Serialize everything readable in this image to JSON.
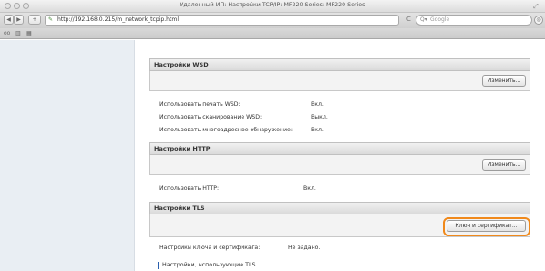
{
  "window": {
    "title": "Удаленный ИП: Настройки TCP/IP: MF220 Series: MF220 Series"
  },
  "toolbar": {
    "back_glyph": "◀",
    "forward_glyph": "▶",
    "add_glyph": "+",
    "url": "http://192.168.0.215/m_network_tcpip.html",
    "reload_glyph": "C",
    "search_placeholder": "Google",
    "search_icon_glyph": "Q▾",
    "download_glyph": "◎"
  },
  "bookmarks_bar": {
    "reading_list_glyph": "oo",
    "top_sites_glyph": "▥",
    "grid_glyph": "▦"
  },
  "sections": {
    "wsd": {
      "title": "Настройки WSD",
      "edit_label": "Изменить...",
      "rows": [
        {
          "label": "Использовать печать WSD:",
          "value": "Вкл."
        },
        {
          "label": "Использовать сканирование WSD:",
          "value": "Выкл."
        },
        {
          "label": "Использовать многоадресное обнаружение:",
          "value": "Вкл."
        }
      ]
    },
    "http": {
      "title": "Настройки HTTP",
      "edit_label": "Изменить...",
      "rows": [
        {
          "label": "Использовать HTTP:",
          "value": "Вкл."
        }
      ]
    },
    "tls": {
      "title": "Настройки TLS",
      "keys_label": "Ключ и сертификат...",
      "rows": [
        {
          "label": "Настройки ключа и сертификата:",
          "value": "Не задано."
        }
      ],
      "subheading": "Настройки, использующие TLS"
    }
  },
  "colors": {
    "highlight": "#f0891b",
    "subheading_accent": "#2a5fae"
  }
}
